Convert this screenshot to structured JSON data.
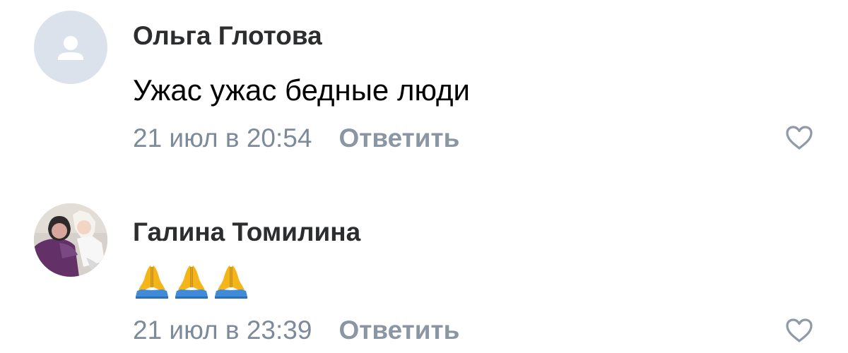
{
  "comments": [
    {
      "author": "Ольга Глотова",
      "avatar": "default-user-avatar",
      "text": "Ужас ужас бедные люди",
      "time": "21 июл в 20:54",
      "reply_label": "Ответить",
      "like_icon": "heart-outline-icon"
    },
    {
      "author": "Галина Томилина",
      "avatar": "photo-avatar",
      "emoji": [
        "folded-hands",
        "folded-hands",
        "folded-hands"
      ],
      "time": "21 июл в 23:39",
      "reply_label": "Ответить",
      "like_icon": "heart-outline-icon"
    }
  ],
  "colors": {
    "author": "#2c2d2e",
    "text": "#000000",
    "meta": "#7d8a99",
    "reply": "#8a96a4",
    "avatar_placeholder": "#dbe2ec",
    "heart": "#8f9aa8"
  }
}
